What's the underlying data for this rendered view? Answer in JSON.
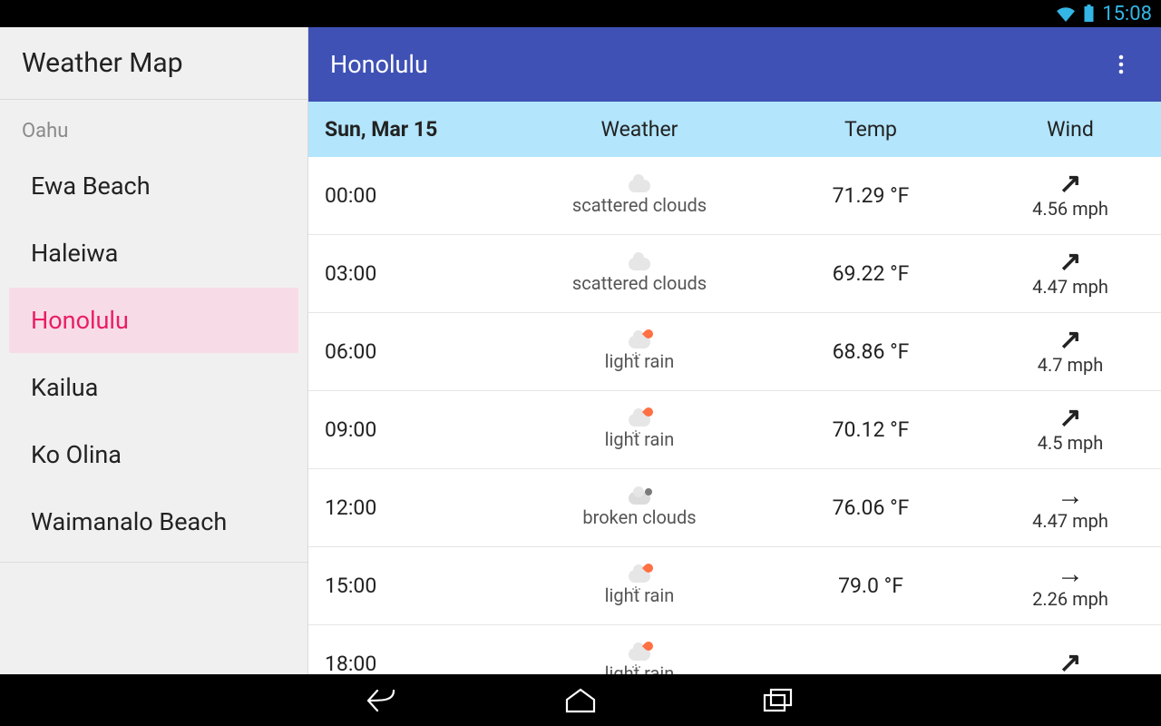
{
  "status": {
    "time": "15:08"
  },
  "sidebar": {
    "title": "Weather Map",
    "group": "Oahu",
    "items": [
      {
        "label": "Ewa Beach"
      },
      {
        "label": "Haleiwa"
      },
      {
        "label": "Honolulu"
      },
      {
        "label": "Kailua"
      },
      {
        "label": "Ko Olina"
      },
      {
        "label": "Waimanalo Beach"
      }
    ],
    "selected_index": 2
  },
  "main": {
    "title": "Honolulu",
    "header": {
      "date": "Sun, Mar 15",
      "weather": "Weather",
      "temp": "Temp",
      "wind": "Wind"
    },
    "rows": [
      {
        "time": "00:00",
        "weather": "scattered clouds",
        "icon": "cloud",
        "temp": "71.29 °F",
        "wind_dir": "ne",
        "wind": "4.56 mph"
      },
      {
        "time": "03:00",
        "weather": "scattered clouds",
        "icon": "cloud",
        "temp": "69.22 °F",
        "wind_dir": "ne",
        "wind": "4.47 mph"
      },
      {
        "time": "06:00",
        "weather": "light rain",
        "icon": "rain",
        "temp": "68.86 °F",
        "wind_dir": "ne",
        "wind": "4.7 mph"
      },
      {
        "time": "09:00",
        "weather": "light rain",
        "icon": "rain",
        "temp": "70.12 °F",
        "wind_dir": "ne",
        "wind": "4.5 mph"
      },
      {
        "time": "12:00",
        "weather": "broken clouds",
        "icon": "broken",
        "temp": "76.06 °F",
        "wind_dir": "e",
        "wind": "4.47 mph"
      },
      {
        "time": "15:00",
        "weather": "light rain",
        "icon": "rain",
        "temp": "79.0 °F",
        "wind_dir": "e",
        "wind": "2.26 mph"
      },
      {
        "time": "18:00",
        "weather": "light rain",
        "icon": "rain",
        "temp": "",
        "wind_dir": "ne",
        "wind": ""
      }
    ]
  }
}
